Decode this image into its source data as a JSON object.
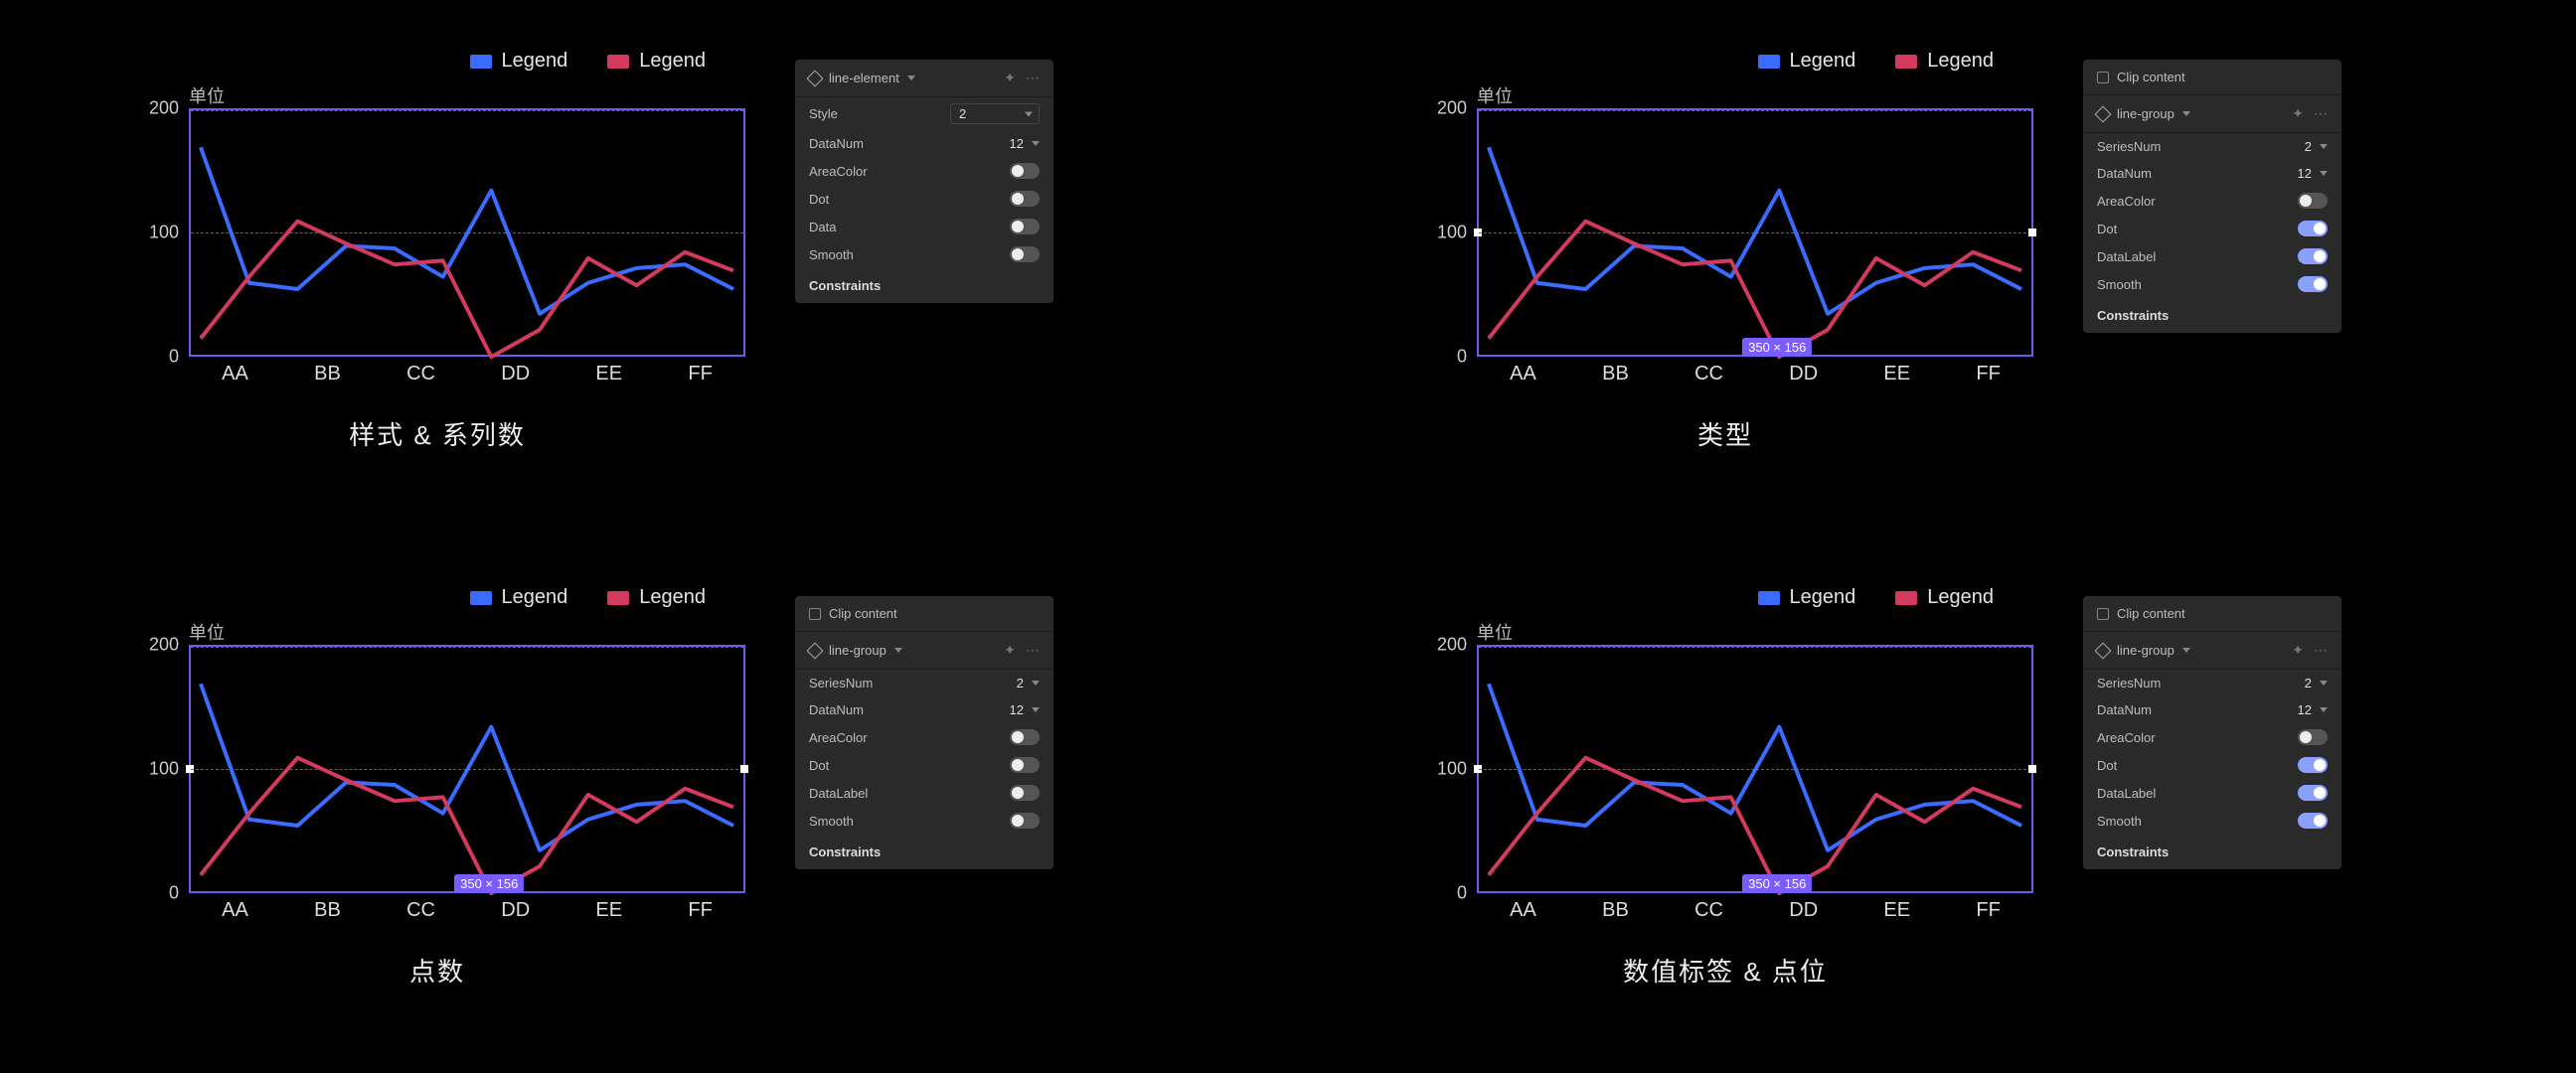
{
  "colors": {
    "series1": "#3a6dff",
    "series2": "#d33a5e",
    "selection": "#7b5cff"
  },
  "chart_data": {
    "type": "line",
    "xlabel": "",
    "ylabel": "单位",
    "ylim": [
      0,
      200
    ],
    "yticks": [
      0,
      100,
      200
    ],
    "categories": [
      "AA",
      "BB",
      "CC",
      "DD",
      "EE",
      "FF"
    ],
    "series": [
      {
        "name": "Legend",
        "color": "#3a6dff",
        "values": [
          170,
          60,
          90,
          135,
          65,
          55
        ],
        "detail": [
          170,
          60,
          55,
          90,
          88,
          65,
          135,
          35,
          60,
          72,
          75,
          55
        ]
      },
      {
        "name": "Legend",
        "color": "#d33a5e",
        "values": [
          15,
          110,
          75,
          0,
          80,
          70
        ],
        "detail": [
          15,
          65,
          110,
          92,
          75,
          78,
          0,
          22,
          80,
          58,
          85,
          70
        ]
      }
    ],
    "note": "The same two-series line chart is repeated four times as a design-tool preview; 'detail' gives the 12-point polyline actually drawn in the mock."
  },
  "axis_unit_label": "单位",
  "legend_labels": [
    "Legend",
    "Legend"
  ],
  "x_categories": [
    "AA",
    "BB",
    "CC",
    "DD",
    "EE",
    "FF"
  ],
  "y_ticks": [
    "200",
    "100",
    "0"
  ],
  "size_badge": "350 × 156",
  "captions": {
    "top_left": "样式 & 系列数",
    "top_right": "类型",
    "bottom_left": "点数",
    "bottom_right": "数值标签 & 点位"
  },
  "clip_content_label": "Clip content",
  "constraints_heading": "Constraints",
  "panel_top_left": {
    "layer_name": "line-element",
    "rows": [
      {
        "label": "Style",
        "kind": "select",
        "value": "2"
      },
      {
        "label": "DataNum",
        "kind": "selectSmall",
        "value": "12"
      },
      {
        "label": "AreaColor",
        "kind": "toggle",
        "on": false
      },
      {
        "label": "Dot",
        "kind": "toggle",
        "on": false
      },
      {
        "label": "Data",
        "kind": "toggle",
        "on": false
      },
      {
        "label": "Smooth",
        "kind": "toggle",
        "on": false
      }
    ]
  },
  "panel_top_right": {
    "layer_name": "line-group",
    "rows": [
      {
        "label": "SeriesNum",
        "kind": "selectSmall",
        "value": "2"
      },
      {
        "label": "DataNum",
        "kind": "selectSmall",
        "value": "12"
      },
      {
        "label": "AreaColor",
        "kind": "toggle",
        "on": false
      },
      {
        "label": "Dot",
        "kind": "toggle",
        "on": true
      },
      {
        "label": "DataLabel",
        "kind": "toggle",
        "on": true
      },
      {
        "label": "Smooth",
        "kind": "toggle",
        "on": true
      }
    ]
  },
  "panel_bottom_left": {
    "layer_name": "line-group",
    "rows": [
      {
        "label": "SeriesNum",
        "kind": "selectSmall",
        "value": "2"
      },
      {
        "label": "DataNum",
        "kind": "selectSmall",
        "value": "12"
      },
      {
        "label": "AreaColor",
        "kind": "toggle",
        "on": false
      },
      {
        "label": "Dot",
        "kind": "toggle",
        "on": false
      },
      {
        "label": "DataLabel",
        "kind": "toggle",
        "on": false
      },
      {
        "label": "Smooth",
        "kind": "toggle",
        "on": false
      }
    ]
  },
  "panel_bottom_right": {
    "layer_name": "line-group",
    "rows": [
      {
        "label": "SeriesNum",
        "kind": "selectSmall",
        "value": "2"
      },
      {
        "label": "DataNum",
        "kind": "selectSmall",
        "value": "12"
      },
      {
        "label": "AreaColor",
        "kind": "toggle",
        "on": false
      },
      {
        "label": "Dot",
        "kind": "toggle",
        "on": true
      },
      {
        "label": "DataLabel",
        "kind": "toggle",
        "on": true
      },
      {
        "label": "Smooth",
        "kind": "toggle",
        "on": true
      }
    ]
  }
}
